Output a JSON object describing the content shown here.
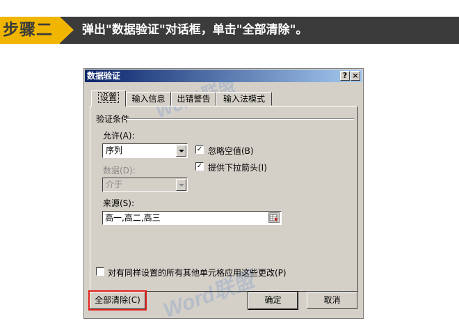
{
  "banner": {
    "step_label": "步骤二",
    "instruction": "弹出\"数据验证\"对话框，单击\"全部清除\"。",
    "colors": {
      "tag": "#f0b500",
      "bar": "#3b3b3b",
      "text": "#ffffff"
    }
  },
  "dialog": {
    "title": "数据验证",
    "help_glyph": "?",
    "close_glyph": "×",
    "tabs": [
      {
        "label": "设置",
        "active": true
      },
      {
        "label": "输入信息",
        "active": false
      },
      {
        "label": "出错警告",
        "active": false
      },
      {
        "label": "输入法模式",
        "active": false
      }
    ],
    "criteria_label": "验证条件",
    "allow": {
      "label": "允许(A):",
      "value": "序列"
    },
    "data": {
      "label": "数据(D):",
      "value": "介于",
      "disabled": true
    },
    "ignore_blank": {
      "label": "忽略空值(B)",
      "checked": true
    },
    "dropdown_arrow": {
      "label": "提供下拉箭头(I)",
      "checked": true
    },
    "source": {
      "label": "来源(S):",
      "value": "高一,高二,高三",
      "icon": "range-select-icon"
    },
    "apply_all": {
      "label": "对有同样设置的所有其他单元格应用这些更改(P)",
      "checked": false
    },
    "buttons": {
      "clear_all": "全部清除(C)",
      "ok": "确定",
      "cancel": "取消"
    },
    "highlight_color": "#e0201b",
    "watermark": "Word联盟"
  }
}
